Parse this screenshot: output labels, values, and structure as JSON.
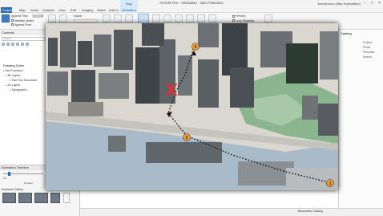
{
  "window": {
    "title": "ArcGIS Pro - Animation - San Francisco",
    "contextual_tab": "Map",
    "user": "Anonymous (Map Exploration)"
  },
  "ribbon_tabs": [
    "Project",
    "Map",
    "Insert",
    "Analysis",
    "View",
    "Edit",
    "Imagery",
    "Share",
    "Add-In",
    "Animation"
  ],
  "ribbon": {
    "append_label": "Append Time",
    "append_value": "00:03:00",
    "maintain_speed_label": "Maintain Speed",
    "append_front_label": "Append Front",
    "create_label": "Create",
    "update_label": "Update",
    "import_label": "Import",
    "group_create": "Create",
    "group_playback": "Playback",
    "group_export": "Export",
    "preview_label": "Preview",
    "loop_label": "Loop Playback",
    "movie_label": "Movie"
  },
  "contents": {
    "header": "Contents",
    "search_placeholder": "Search",
    "drawing_order": "Drawing Order",
    "map_name": "San Francisco",
    "layers": [
      "3D Layers",
      "San Fran Downtown",
      "2D Layers",
      "Topographic"
    ]
  },
  "timeline": {
    "header": "Animation Timeline",
    "time_label": "0.0",
    "duration_label": "Duration",
    "keyframe_gallery": "Keyframe Gallery",
    "thumbs_count": 4
  },
  "right_pane": {
    "title": "Catalog",
    "item1": "Project",
    "item2": "Portal",
    "item3": "Favorites",
    "item4": "History"
  },
  "bottom_tabs": "Bookmarks   Catalog",
  "map": {
    "waypoints": [
      {
        "label": "1"
      },
      {
        "label": "2"
      },
      {
        "label": "3"
      }
    ],
    "marker": "X",
    "colors": {
      "waypoint": "#f0a030",
      "marker": "#e03030",
      "path": "#111111"
    }
  }
}
